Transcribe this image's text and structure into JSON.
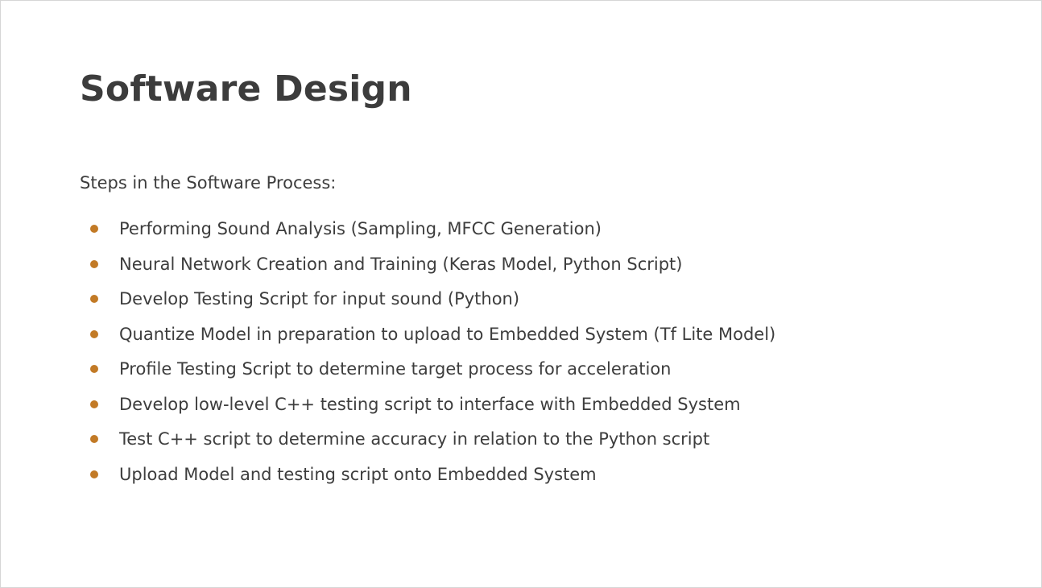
{
  "slide": {
    "title": "Software Design",
    "intro": "Steps in the Software Process:",
    "bullet_color": "#c27a26",
    "steps": [
      "Performing Sound Analysis (Sampling, MFCC Generation)",
      "Neural Network Creation and Training (Keras Model, Python Script)",
      "Develop Testing Script for input sound (Python)",
      "Quantize Model in preparation to upload to Embedded System (Tf Lite Model)",
      "Profile Testing Script to determine target process for acceleration",
      "Develop low-level C++ testing script to interface with Embedded System",
      "Test C++ script to determine accuracy in relation to the Python script",
      "Upload Model and testing script onto Embedded System"
    ]
  }
}
